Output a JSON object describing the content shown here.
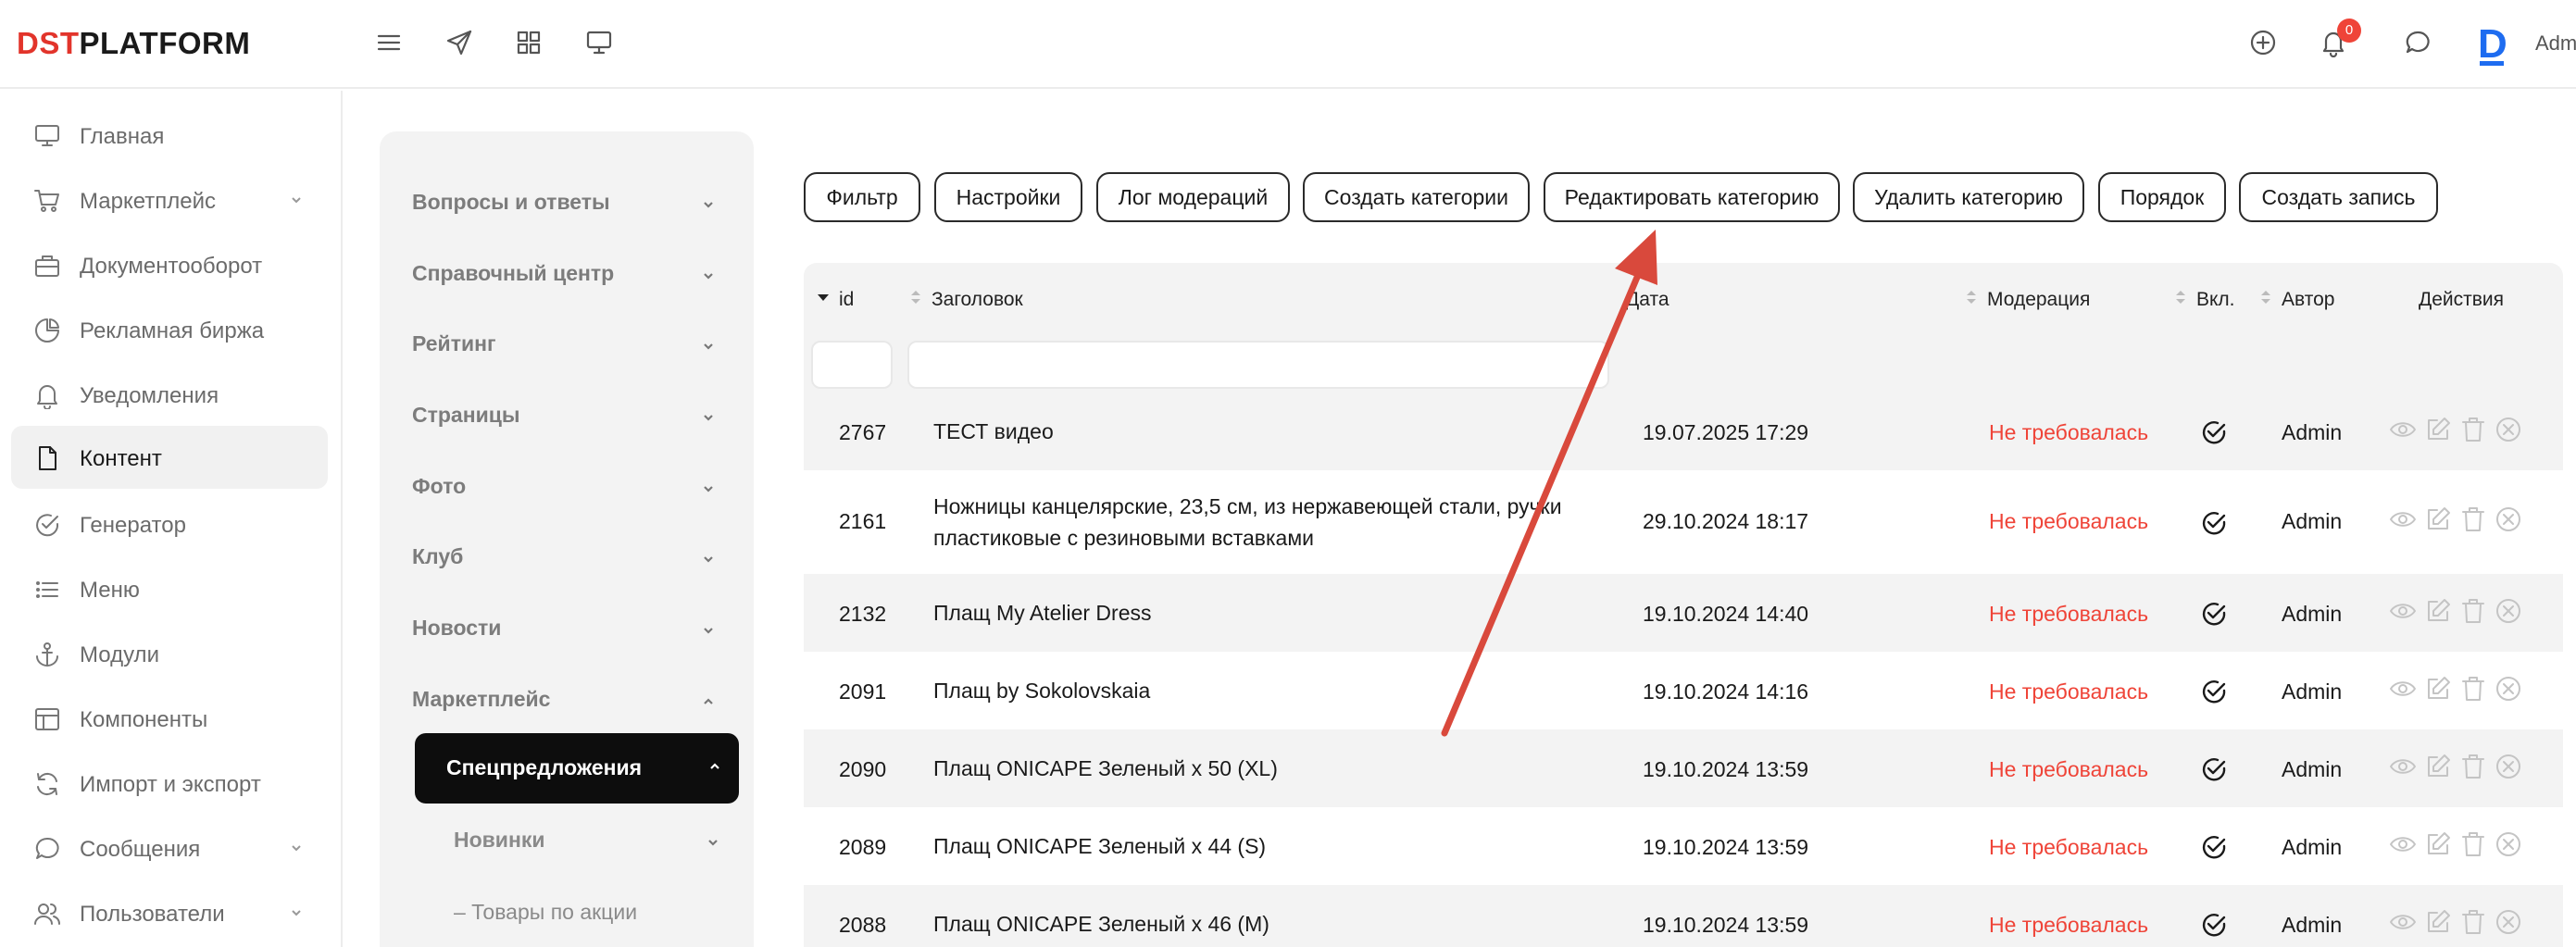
{
  "header": {
    "logo_accent": "DST",
    "logo_rest": "PLATFORM",
    "notifications_count": "0",
    "brand_letter": "D",
    "user_name": "Adm",
    "icons": [
      "menu-icon",
      "send-icon",
      "grid-icon",
      "monitor-icon",
      "plus-circle-icon",
      "bell-icon",
      "chat-icon"
    ]
  },
  "sidebar": {
    "items": [
      {
        "label": "Главная",
        "icon": "monitor-icon"
      },
      {
        "label": "Маркетплейс",
        "icon": "cart-icon"
      },
      {
        "label": "Документооборот",
        "icon": "briefcase-icon"
      },
      {
        "label": "Рекламная биржа",
        "icon": "pie-chart-icon"
      },
      {
        "label": "Уведомления",
        "icon": "bell-icon"
      },
      {
        "label": "Контент",
        "icon": "file-icon"
      },
      {
        "label": "Генератор",
        "icon": "check-circle-icon"
      },
      {
        "label": "Меню",
        "icon": "list-icon"
      },
      {
        "label": "Модули",
        "icon": "anchor-icon"
      },
      {
        "label": "Компоненты",
        "icon": "layout-icon"
      },
      {
        "label": "Импорт и экспорт",
        "icon": "refresh-icon"
      },
      {
        "label": "Сообщения",
        "icon": "message-icon"
      },
      {
        "label": "Пользователи",
        "icon": "users-icon"
      }
    ],
    "active": "Контент"
  },
  "categories": {
    "items": [
      "Вопросы и ответы",
      "Справочный центр",
      "Рейтинг",
      "Страницы",
      "Фото",
      "Клуб",
      "Новости",
      "Маркетплейс"
    ],
    "active": "Спецпредложения",
    "sub": "Новинки",
    "sub2": "– Товары по акции"
  },
  "toolbar": {
    "buttons": [
      "Фильтр",
      "Настройки",
      "Лог модераций",
      "Создать категории",
      "Редактировать категорию",
      "Удалить категорию",
      "Порядок",
      "Создать запись"
    ]
  },
  "table": {
    "columns": {
      "id": "id",
      "title": "Заголовок",
      "date": "Дата",
      "moderation": "Модерация",
      "enabled": "Вкл.",
      "author": "Автор",
      "actions": "Действия"
    },
    "rows": [
      {
        "id": "2767",
        "title": "ТЕСТ видео",
        "date": "19.07.2025 17:29",
        "moderation": "Не требовалась",
        "author": "Admin"
      },
      {
        "id": "2161",
        "title": "Ножницы канцелярские, 23,5 см, из нержавеющей стали, ручки пластиковые с резиновыми вставками",
        "date": "29.10.2024 18:17",
        "moderation": "Не требовалась",
        "author": "Admin"
      },
      {
        "id": "2132",
        "title": "Плащ My Atelier Dress",
        "date": "19.10.2024 14:40",
        "moderation": "Не требовалась",
        "author": "Admin"
      },
      {
        "id": "2091",
        "title": "Плащ by Sokolovskaia",
        "date": "19.10.2024 14:16",
        "moderation": "Не требовалась",
        "author": "Admin"
      },
      {
        "id": "2090",
        "title": "Плащ ONICAPE Зеленый x 50 (XL)",
        "date": "19.10.2024 13:59",
        "moderation": "Не требовалась",
        "author": "Admin"
      },
      {
        "id": "2089",
        "title": "Плащ ONICAPE Зеленый x 44 (S)",
        "date": "19.10.2024 13:59",
        "moderation": "Не требовалась",
        "author": "Admin"
      },
      {
        "id": "2088",
        "title": "Плащ ONICAPE Зеленый x 46 (M)",
        "date": "19.10.2024 13:59",
        "moderation": "Не требовалась",
        "author": "Admin"
      }
    ]
  },
  "colors": {
    "accent_red": "#ef4438",
    "brand_blue": "#1e6cf0",
    "annotation_arrow": "#d9493c"
  }
}
